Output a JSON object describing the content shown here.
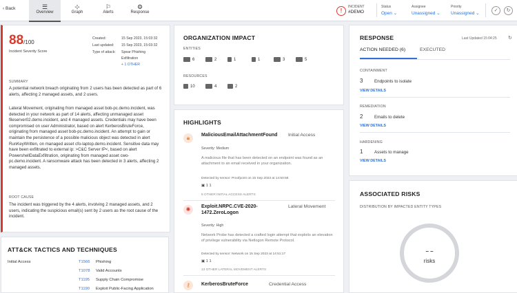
{
  "topbar": {
    "back_label": "Back",
    "tabs": [
      {
        "label": "Overview",
        "icon": "list-icon"
      },
      {
        "label": "Graph",
        "icon": "graph-icon"
      },
      {
        "label": "Alerts",
        "icon": "bell-icon"
      },
      {
        "label": "Response",
        "icon": "gear-icon"
      }
    ],
    "incident_label": "INCIDENT",
    "incident_id": "#DEMO",
    "status_label": "Status",
    "status_value": "Open ⌄",
    "assignee_label": "Assignee",
    "assignee_value": "Unassigned ⌄",
    "priority_label": "Priority",
    "priority_value": "Unassigned ⌄"
  },
  "score": {
    "value": "88",
    "max": "/100",
    "label": "Incident Severity Score",
    "created_label": "Created:",
    "created": "15 Sep 2023, 15:03:32",
    "updated_label": "Last updated:",
    "updated": "15 Sep 2023, 15:03:32",
    "attack_label": "Type of attack:",
    "attack_1": "Spear Phishing",
    "attack_2": "Exfiltration",
    "attack_more": "+ 1 OTHER"
  },
  "summary": {
    "heading": "SUMMARY",
    "p1": "A potential network breach originating from 2 users has been detected as part of 6 alerts, affecting 2 managed assets, and 2 users.",
    "p2": "Lateral Movement, originating from managed asset bob-pc.demo.incident, was detected in your network as part of 14 alerts, affecting unmanaged asset fileserver02.demo.incident, and 4 managed assets. Credentials may have been compromised on user Administrator, based on alert KerberosBruteForce, originating from managed asset bob-pc.demo.incident. An attempt to gain or maintain the persistence of a possible malicious object was detected in alert RunKeyWritten, on managed asset cfo-laptop.demo.incident. Sensitive data may have been exfiltrated to external ip: >C&C Server IP<, based on alert PowershellDataExfiltration, originating from managed asset cwo-pc.demo.incident. A ransomware attack has been detected in 3 alerts, affecting 2 managed assets.",
    "root_heading": "ROOT CAUSE",
    "p3": "The incident was triggered by the 4 alerts, involving 2 managed assets, and 2 users, indicating the suspicious email(s) sent by 2 users as the root cause of the incident."
  },
  "attck": {
    "title": "ATT&CK TACTICS AND TECHNIQUES",
    "tactic": "Initial Access",
    "rows": [
      {
        "id": "T1566",
        "name": "Phishing"
      },
      {
        "id": "T1078",
        "name": "Valid Accounts"
      },
      {
        "id": "T1195",
        "name": "Supply Chain Compromise"
      },
      {
        "id": "T1190",
        "name": "Exploit Public-Facing Application"
      }
    ]
  },
  "impact": {
    "title": "ORGANIZATION IMPACT",
    "entities_label": "ENTITIES",
    "entities": [
      "6",
      "2",
      "1",
      "1",
      "3",
      "5"
    ],
    "resources_label": "RESOURCES",
    "resources": [
      "10",
      "4",
      "2"
    ]
  },
  "highlights": {
    "title": "HIGHLIGHTS",
    "items": [
      {
        "name": "MaliciousEmailAttachmentFound",
        "type": "Initial Access",
        "severity": "Severity:  Medium",
        "desc": "A malicious file that has been detected on an endpoint was found as an attachment to an email received in your organization.",
        "detected": "Detected by sensor: Proofpoint on 15 Sep 2023 at 14:50:56",
        "counts": "1  1",
        "more": "5 OTHER INITIAL ACCESS ALERTS"
      },
      {
        "name": "Exploit.NRPC.CVE-2020-1472.ZeroLogon",
        "type": "Lateral Movement",
        "severity": "Severity:  High",
        "desc": "Network Probe has detected a crafted login attempt that exploits an elevation of privilege vulnerability via Netlogon Remote Protocol.",
        "detected": "Detected by sensor: Network on 15 Sep 2023 at 14:51:17",
        "counts": "1  1",
        "more": "13 OTHER LATERAL MOVEMENT ALERTS"
      },
      {
        "name": "KerberosBruteForce",
        "type": "Credential Access"
      }
    ]
  },
  "response": {
    "title": "RESPONSE",
    "updated": "Last Updated 15:04:25",
    "tab_needed": "ACTION NEEDED (6)",
    "tab_executed": "EXECUTED",
    "sections": [
      {
        "heading": "CONTAINMENT",
        "num": "3",
        "text": "Endpoints to isolate",
        "link": "VIEW DETAILS"
      },
      {
        "heading": "REMEDIATION",
        "num": "2",
        "text": "Emails to delete",
        "link": "VIEW DETAILS"
      },
      {
        "heading": "HARDENING",
        "num": "1",
        "text": "Assets to manage",
        "link": "VIEW DETAILS"
      }
    ]
  },
  "risks": {
    "title": "ASSOCIATED RISKS",
    "subtitle": "DISTRIBUTION BY IMPACTED ENTITY TYPES",
    "dash": "– –",
    "label": "risks"
  },
  "colors": {
    "accent": "#2f6fd6",
    "danger": "#d73a2c",
    "warning": "#e9833b"
  }
}
